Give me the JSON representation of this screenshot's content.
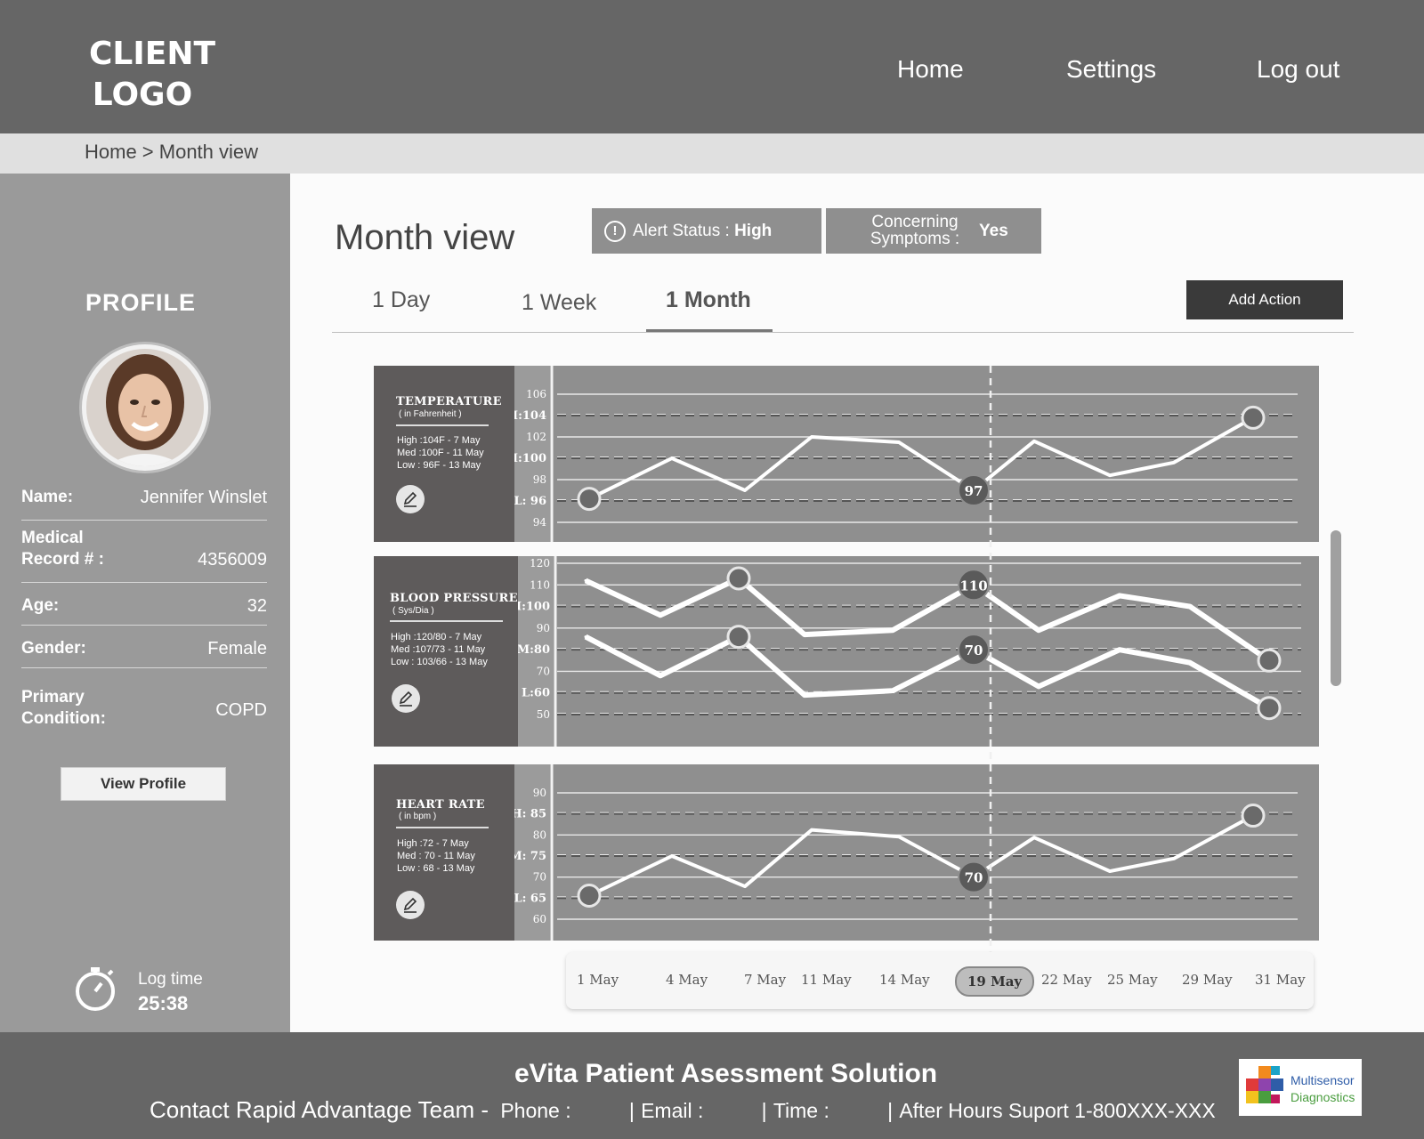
{
  "header": {
    "logo_line1": "CLIENT",
    "logo_line2": "LOGO",
    "nav": [
      "Home",
      "Settings",
      "Log out"
    ]
  },
  "breadcrumb": "Home > Month view",
  "sidebar": {
    "heading": "PROFILE",
    "fields": [
      {
        "label": "Name:",
        "value": "Jennifer Winslet"
      },
      {
        "label": "Medical Record # :",
        "value": "4356009"
      },
      {
        "label": "Age:",
        "value": "32"
      },
      {
        "label": "Gender:",
        "value": "Female"
      },
      {
        "label": "Primary Condition:",
        "value": "COPD"
      }
    ],
    "view_profile": "View Profile",
    "log_time_label": "Log time",
    "log_time_value": "25:38"
  },
  "main": {
    "title": "Month view",
    "alert_label": "Alert Status :",
    "alert_value": "High",
    "concern_label": "Concerning Symptoms :",
    "concern_value": "Yes",
    "tabs": [
      {
        "label": "1 Day",
        "active": false
      },
      {
        "label": "1 Week",
        "active": false
      },
      {
        "label": "1 Month",
        "active": true
      }
    ],
    "add_action": "Add Action"
  },
  "chart_data": [
    {
      "type": "line",
      "title": "TEMPERATURE",
      "unit": "( in Fahrenheit )",
      "stats": [
        "High :104F - 7 May",
        "Med :100F - 11 May",
        "Low : 96F - 13 May"
      ],
      "y_ticks": [
        "106",
        "H:104",
        "102",
        "M:100",
        "98",
        "L: 96",
        "94"
      ],
      "ylim": [
        94,
        106
      ],
      "series": [
        {
          "values": [
            96.2,
            100.0,
            97.0,
            102.0,
            101.5,
            97.0,
            101.6,
            98.4,
            99.6,
            103.8
          ]
        }
      ],
      "highlight_value": "97"
    },
    {
      "type": "line",
      "title": "BLOOD PRESSURE",
      "unit": "( Sys/Dia )",
      "stats": [
        "High :120/80 - 7 May",
        "Med :107/73 - 11 May",
        "Low : 103/66 - 13 May"
      ],
      "y_ticks": [
        "120",
        "110",
        "H:100",
        "90",
        "M:80",
        "70",
        "L:60",
        "50"
      ],
      "ylim": [
        50,
        120
      ],
      "series": [
        {
          "values": [
            112,
            96,
            113,
            87,
            89,
            110,
            89,
            105,
            100,
            75
          ]
        },
        {
          "values": [
            86,
            68,
            86,
            59,
            61,
            80,
            63,
            80,
            74,
            53
          ]
        }
      ],
      "highlight_values": [
        "110",
        "70"
      ]
    },
    {
      "type": "line",
      "title": "HEART RATE",
      "unit": "( in bpm )",
      "stats": [
        "High :72 - 7 May",
        "Med : 70 - 11 May",
        "Low : 68 - 13 May"
      ],
      "y_ticks": [
        "90",
        "H: 85",
        "80",
        "M: 75",
        "70",
        "L: 65",
        "60"
      ],
      "ylim": [
        60,
        90
      ],
      "series": [
        {
          "values": [
            65.6,
            75.0,
            67.8,
            81.2,
            79.6,
            70.0,
            79.4,
            71.4,
            74.4,
            84.6
          ]
        }
      ],
      "highlight_value": "70"
    }
  ],
  "dates": [
    "1 May",
    "4 May",
    "7 May",
    "11 May",
    "14 May",
    "19 May",
    "22 May",
    "25 May",
    "29 May",
    "31 May"
  ],
  "selected_date": "19 May",
  "footer": {
    "title": "eVita   Patient Asessment Solution",
    "contact_lead": "Contact Rapid Advantage Team -",
    "phone": "Phone :",
    "email": "Email :",
    "time": "Time :",
    "after_hours": "After Hours Suport 1-800XXX-XXX",
    "partner_line1": "Multisensor",
    "partner_line2": "Diagnostics"
  },
  "colors": {
    "header_bg": "#666666",
    "sidebar_bg": "#9a9a9a",
    "chart_bg": "#8f8f8f",
    "label_panel": "#5e5b5b",
    "line": "#ffffff",
    "partner_blue": "#2f5da8",
    "partner_green": "#4a9d3f"
  }
}
